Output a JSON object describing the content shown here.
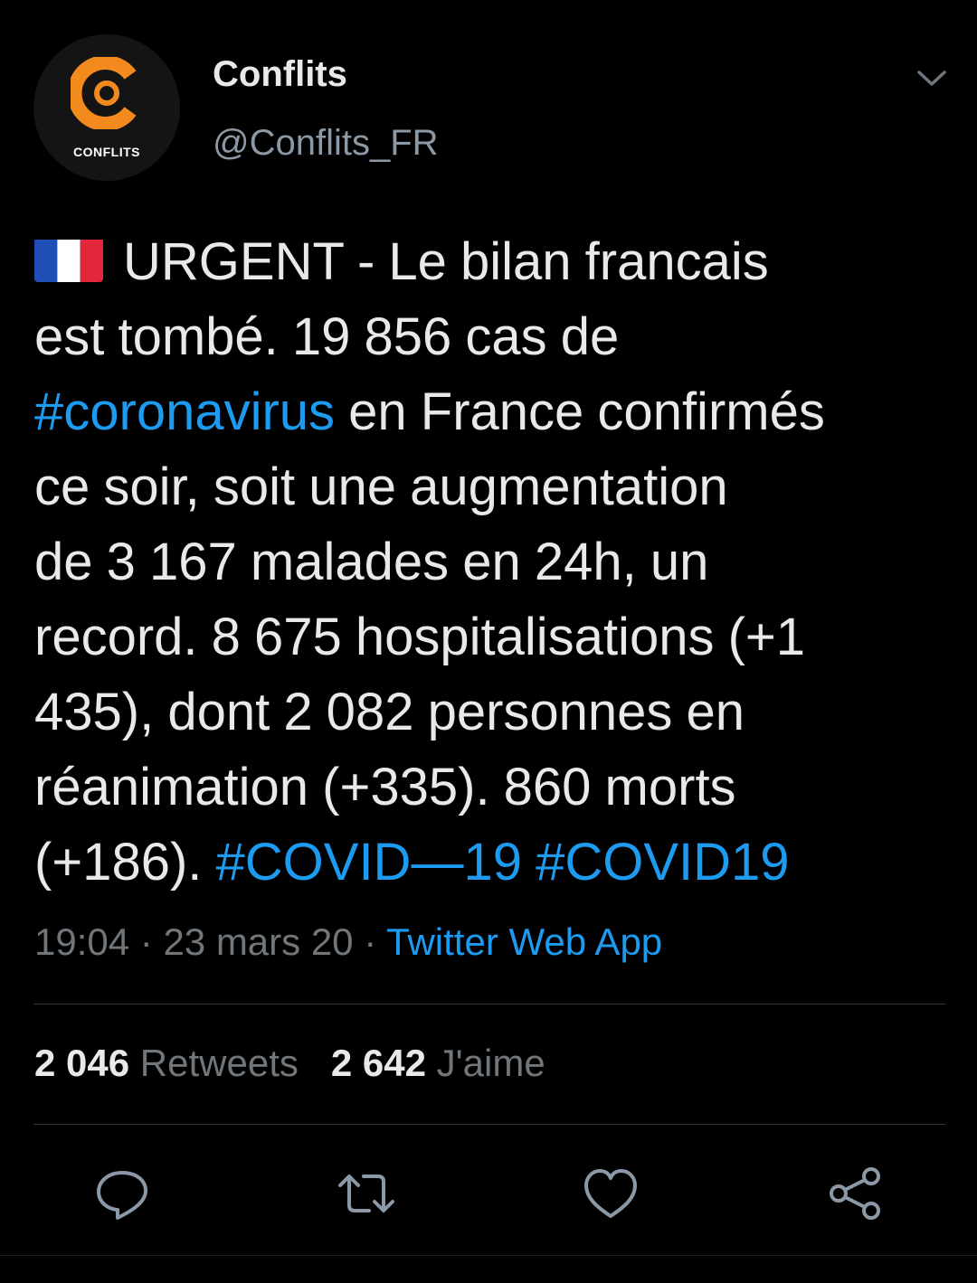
{
  "author": {
    "display_name": "Conflits",
    "handle": "@Conflits_FR",
    "avatar_label": "CONFLITS",
    "avatar_icon": "conflits-logo"
  },
  "tweet": {
    "flag_icon": "france-flag-emoji",
    "lines": [
      "URGENT - Le bilan francais",
      "est tombé. 19 856 cas de",
      "#coronavirus",
      " en France confirmés",
      "ce soir, soit une augmentation",
      "de 3 167 malades en 24h, un",
      "record. 8 675 hospitalisations (+1",
      "435), dont 2 082 personnes en",
      "réanimation (+335). 860 morts",
      "(+186). ",
      "#COVID—19",
      " ",
      "#COVID19"
    ]
  },
  "meta": {
    "time": "19:04",
    "sep1": " · ",
    "date": "23 mars 20",
    "sep2": " · ",
    "source": "Twitter Web App"
  },
  "stats": {
    "retweets_count": "2 046",
    "retweets_label": "Retweets",
    "likes_count": "2 642",
    "likes_label": "J'aime"
  },
  "actions": [
    "reply-icon",
    "retweet-icon",
    "like-icon",
    "share-icon"
  ],
  "colors": {
    "background": "#000000",
    "text": "#e7e9ea",
    "secondary": "#71767b",
    "link": "#1d9bf0",
    "logo_orange": "#f28a1e"
  }
}
